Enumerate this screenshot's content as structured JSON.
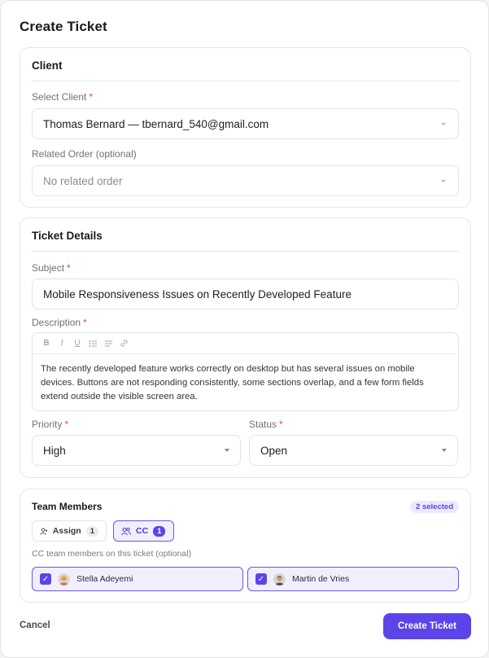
{
  "modal": {
    "title": "Create Ticket"
  },
  "client_section": {
    "title": "Client",
    "client_label": "Select Client",
    "client_value": "Thomas Bernard — tbernard_540@gmail.com",
    "order_label": "Related Order (optional)",
    "order_placeholder": "No related order"
  },
  "details_section": {
    "title": "Ticket Details",
    "subject_label": "Subject",
    "subject_value": "Mobile Responsiveness Issues on Recently Developed Feature",
    "description_label": "Description",
    "toolbar": {
      "bold": "B",
      "italic": "I",
      "underline": "U"
    },
    "description_value": "The recently developed feature works correctly on desktop but has several issues on mobile devices. Buttons are not responding consistently, some sections overlap, and a few form fields extend outside the visible screen area.",
    "priority_label": "Priority",
    "priority_value": "High",
    "status_label": "Status",
    "status_value": "Open"
  },
  "required_marker": "*",
  "team_section": {
    "title": "Team Members",
    "selected_badge": "2 selected",
    "assign_label": "Assign",
    "assign_count": "1",
    "cc_label": "CC",
    "cc_count": "1",
    "hint": "CC team members on this ticket (optional)",
    "members": [
      {
        "name": "Stella Adeyemi",
        "checked": true
      },
      {
        "name": "Martin de Vries",
        "checked": true
      }
    ]
  },
  "footer": {
    "cancel_label": "Cancel",
    "submit_label": "Create Ticket"
  },
  "colors": {
    "accent": "#5b45e8",
    "required": "#e5484d",
    "border": "#e3e3e8"
  },
  "icons": [
    "chevron-down-icon",
    "caret-down-icon",
    "bold-icon",
    "italic-icon",
    "underline-icon",
    "bullet-list-icon",
    "align-icon",
    "link-icon",
    "assign-user-icon",
    "cc-users-icon",
    "check-icon"
  ]
}
